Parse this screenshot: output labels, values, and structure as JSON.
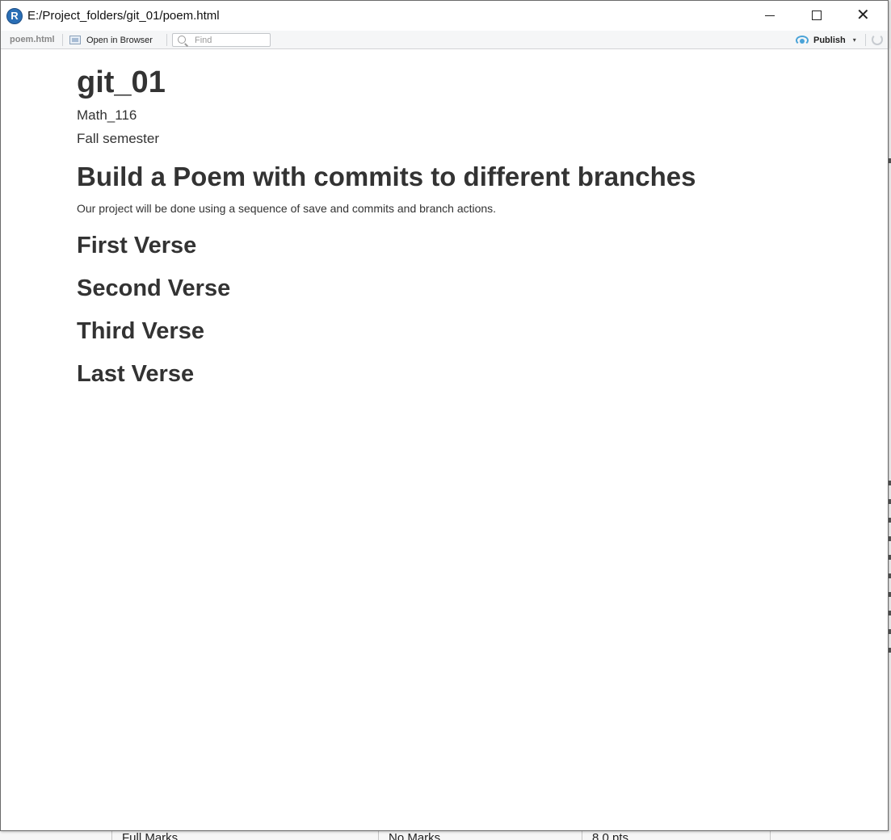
{
  "window": {
    "title": "E:/Project_folders/git_01/poem.html",
    "app_icon_letter": "R"
  },
  "toolbar": {
    "tab_label": "poem.html",
    "open_in_browser_label": "Open in Browser",
    "find_placeholder": "Find",
    "publish_label": "Publish",
    "publish_caret": "▾"
  },
  "document": {
    "title": "git_01",
    "author": "Math_116",
    "date": "Fall semester",
    "heading": "Build a Poem with commits to different branches",
    "paragraph": "Our project will be done using a sequence of save and commits and branch actions.",
    "sections": [
      "First Verse",
      "Second Verse",
      "Third Verse",
      "Last Verse"
    ]
  },
  "background_app": {
    "bottom_cells": [
      "Full Marks",
      "No Marks",
      "8.0 pts"
    ]
  },
  "colors": {
    "text": "#333333",
    "publish_accent": "#4aa3d8",
    "app_icon": "#2a6fb6"
  }
}
